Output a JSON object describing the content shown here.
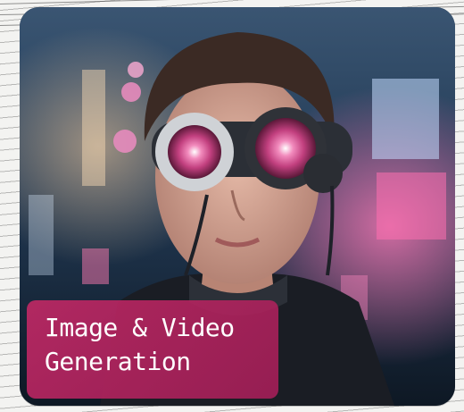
{
  "card": {
    "title": "Image & Video\nGeneration",
    "image_label": "cyberpunk-portrait-image",
    "accent_color": "#c42a66"
  }
}
